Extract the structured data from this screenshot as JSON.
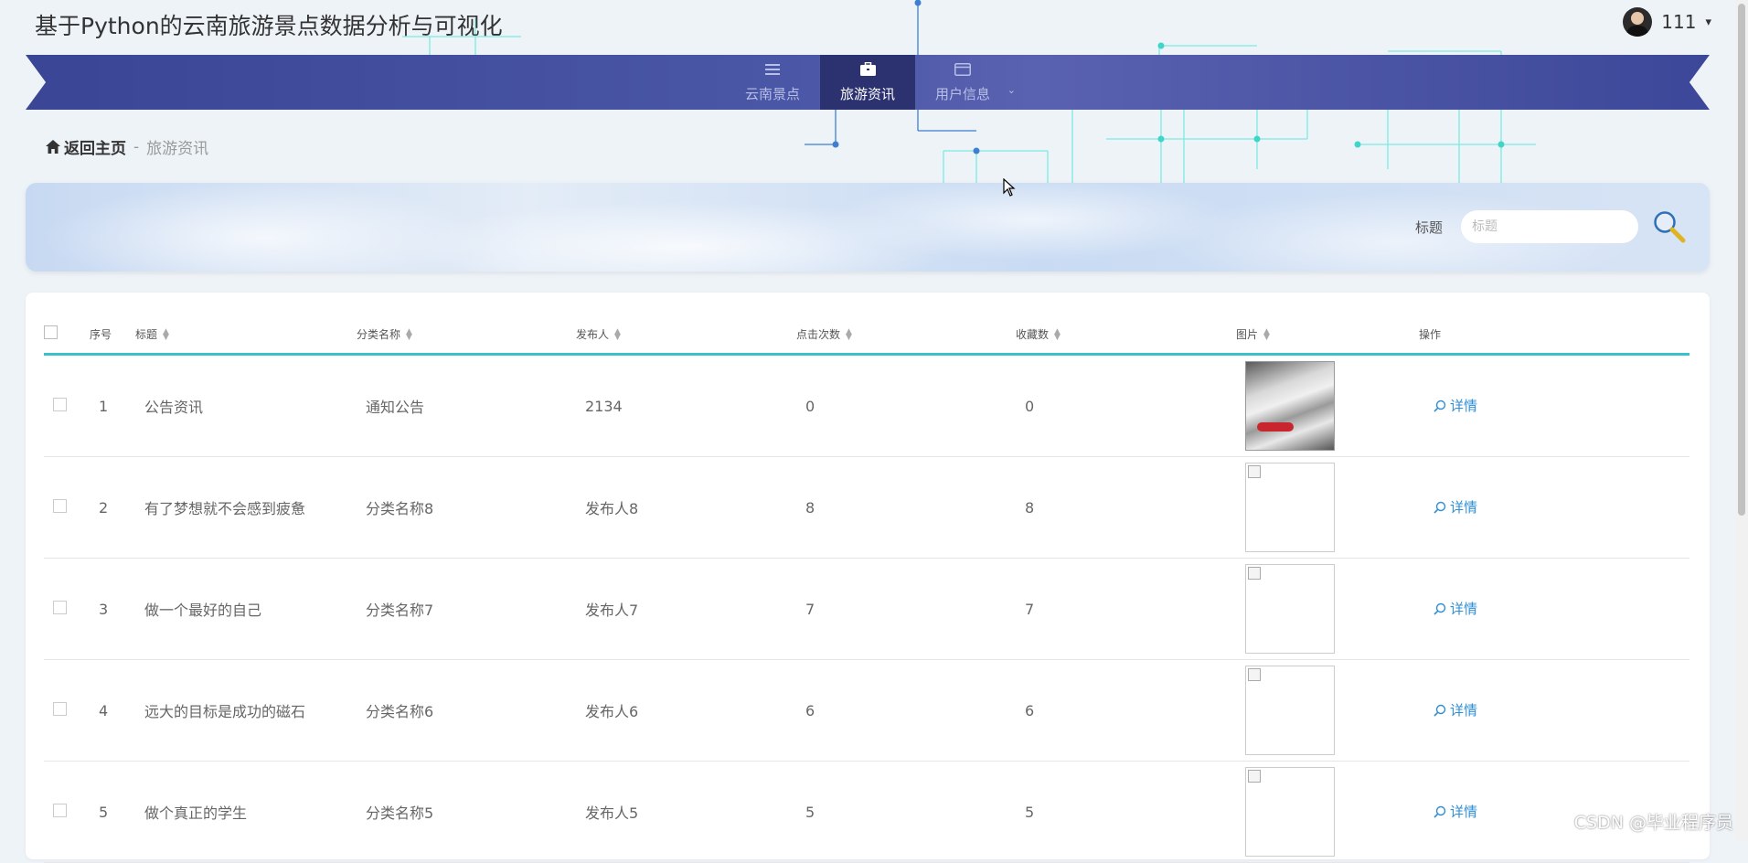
{
  "app": {
    "title": "基于Python的云南旅游景点数据分析与可视化"
  },
  "user": {
    "name": "111",
    "caret": "▾"
  },
  "nav": {
    "items": [
      {
        "label": "云南景点",
        "icon": "list-icon"
      },
      {
        "label": "旅游资讯",
        "icon": "briefcase-icon",
        "active": true
      },
      {
        "label": "用户信息",
        "icon": "card-icon"
      }
    ]
  },
  "breadcrumb": {
    "home": "返回主页",
    "separator": "-",
    "current": "旅游资讯"
  },
  "search": {
    "label": "标题",
    "placeholder": "标题"
  },
  "table": {
    "headers": {
      "index": "序号",
      "title": "标题",
      "category": "分类名称",
      "publisher": "发布人",
      "clicks": "点击次数",
      "favorites": "收藏数",
      "image": "图片",
      "actions": "操作"
    },
    "detail_label": "详情",
    "rows": [
      {
        "index": "1",
        "title": "公告资讯",
        "category": "通知公告",
        "publisher": "2134",
        "clicks": "0",
        "favorites": "0"
      },
      {
        "index": "2",
        "title": "有了梦想就不会感到疲惫",
        "category": "分类名称8",
        "publisher": "发布人8",
        "clicks": "8",
        "favorites": "8"
      },
      {
        "index": "3",
        "title": "做一个最好的自己",
        "category": "分类名称7",
        "publisher": "发布人7",
        "clicks": "7",
        "favorites": "7"
      },
      {
        "index": "4",
        "title": "远大的目标是成功的磁石",
        "category": "分类名称6",
        "publisher": "发布人6",
        "clicks": "6",
        "favorites": "6"
      },
      {
        "index": "5",
        "title": "做个真正的学生",
        "category": "分类名称5",
        "publisher": "发布人5",
        "clicks": "5",
        "favorites": "5"
      }
    ]
  },
  "colors": {
    "nav_dark": "#2c3170",
    "nav_bar": "#4a56a6",
    "accent": "#3cc0c8",
    "link": "#2d8fd5"
  },
  "watermark": "CSDN @毕业程序员"
}
